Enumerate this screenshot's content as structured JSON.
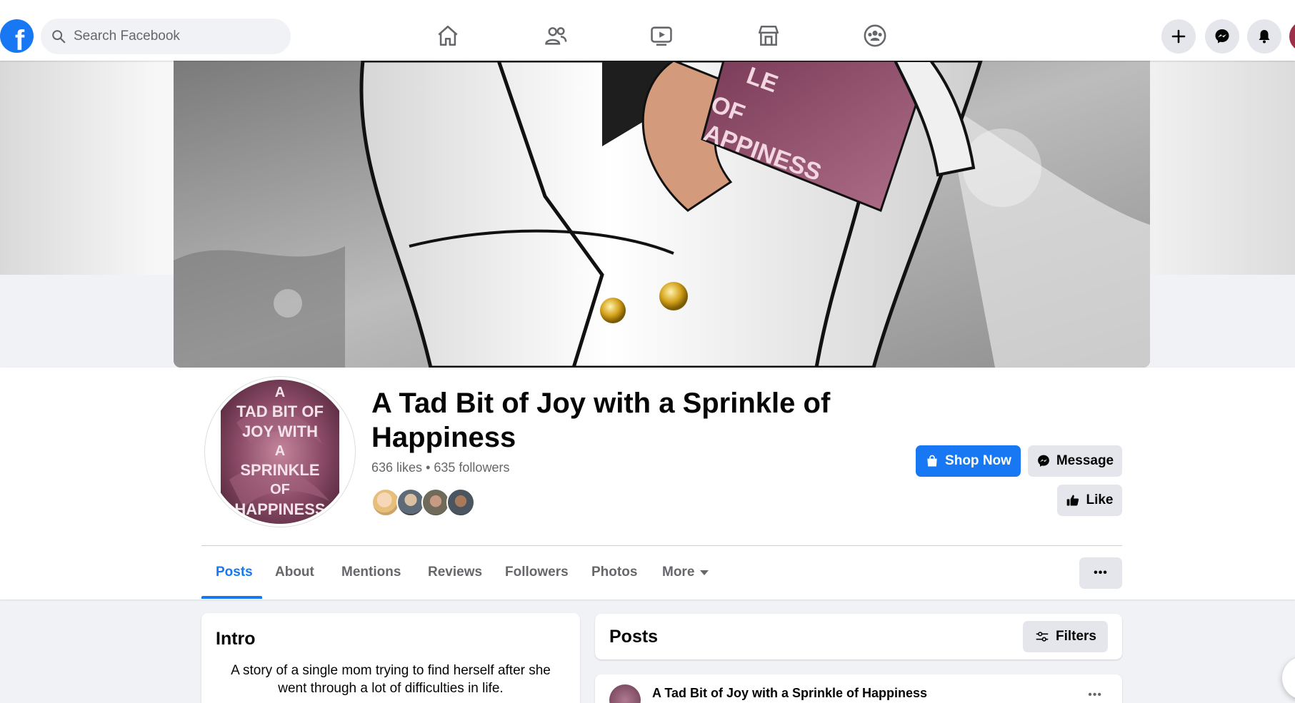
{
  "nav": {
    "logo": "f",
    "search_placeholder": "Search Facebook",
    "icons": [
      "home-icon",
      "friends-icon",
      "watch-icon",
      "marketplace-icon",
      "groups-icon"
    ],
    "right_icons": [
      "plus-icon",
      "messenger-icon",
      "bell-icon"
    ],
    "brand_color": "#1877f2"
  },
  "page": {
    "title": "A Tad Bit of Joy with a Sprinkle of Happiness",
    "likes": "636 likes",
    "separator": "•",
    "followers": "635 followers",
    "profile_text_lines": [
      "A",
      "TAD BIT OF",
      "JOY WITH",
      "A",
      "SPRINKLE",
      "OF",
      "HAPPINESS"
    ],
    "cover_book_text": [
      "LE",
      "OF",
      "APPINESS"
    ]
  },
  "actions": {
    "shop_now": "Shop Now",
    "message": "Message",
    "like": "Like"
  },
  "tabs": {
    "items": [
      "Posts",
      "About",
      "Mentions",
      "Reviews",
      "Followers",
      "Photos",
      "More"
    ],
    "active": "Posts",
    "overflow": "•••"
  },
  "intro": {
    "heading": "Intro",
    "text": "A story of a single mom trying to find herself after she went through a lot of difficulties in life."
  },
  "posts": {
    "heading": "Posts",
    "filters_label": "Filters",
    "first_post_author": "A Tad Bit of Joy with a Sprinkle of Happiness",
    "post_menu": "•••"
  }
}
